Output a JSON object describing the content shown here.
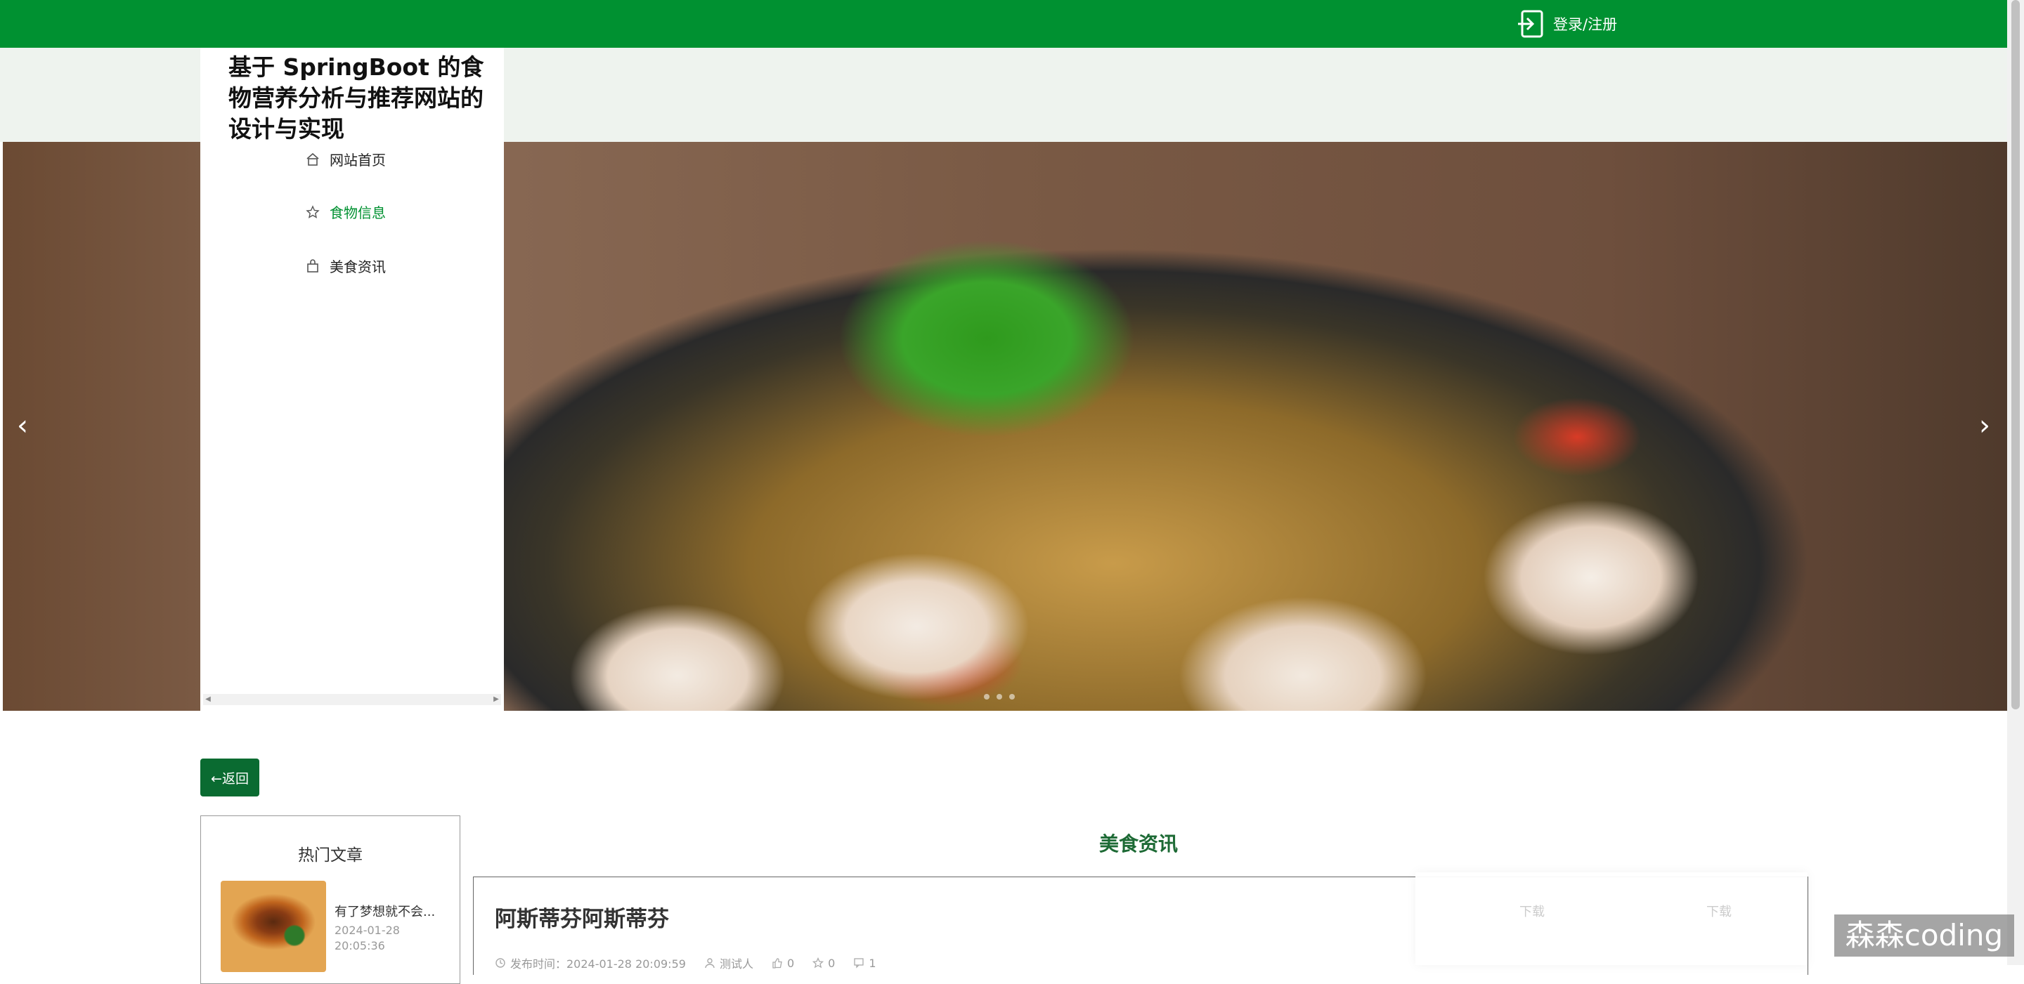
{
  "header": {
    "login_label": "登录/注册",
    "bg_color": "#009131",
    "login_icon": "login-icon"
  },
  "site": {
    "title": "基于 SpringBoot 的食物营养分析与推荐网站的设计与实现"
  },
  "nav": {
    "items": [
      {
        "label": "网站首页",
        "icon": "home-icon"
      },
      {
        "label": "食物信息",
        "icon": "star-icon",
        "active": true
      },
      {
        "label": "美食资讯",
        "icon": "bag-icon"
      }
    ]
  },
  "banner": {
    "slide_count": 3,
    "active_slide": 1
  },
  "back_button": {
    "label": "←返回"
  },
  "sidebar": {
    "title": "热门文章",
    "articles": [
      {
        "name": "有了梦想就不会...",
        "date": "2024-01-28 20:05:36"
      }
    ]
  },
  "main": {
    "section_title": "美食资讯",
    "article": {
      "title": "阿斯蒂芬阿斯蒂芬",
      "publish_time": "发布时间：2024-01-28 20:09:59",
      "author": "测试人",
      "likes": "0",
      "favorites": "0",
      "comments": "1"
    }
  },
  "overlay": {
    "left_label": "下载",
    "right_label": "下载"
  },
  "watermark": {
    "text": "森森coding"
  },
  "colors": {
    "accent": "#009131",
    "back_button": "#0a6b31",
    "section_title": "#1d6a35"
  }
}
